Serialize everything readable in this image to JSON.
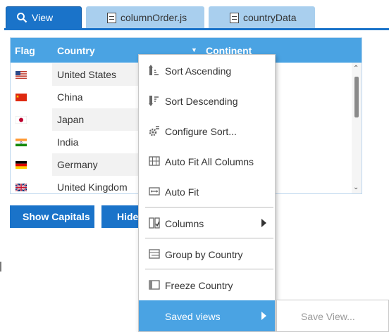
{
  "tabs": [
    {
      "label": "View",
      "icon": "search-icon"
    },
    {
      "label": "columnOrder.js",
      "icon": "file-icon"
    },
    {
      "label": "countryData",
      "icon": "file-icon"
    }
  ],
  "grid": {
    "headers": {
      "flag": "Flag",
      "country": "Country",
      "continent": "Continent"
    },
    "rows": [
      {
        "flag": "us-flag-icon",
        "country": "United States"
      },
      {
        "flag": "cn-flag-icon",
        "country": "China"
      },
      {
        "flag": "jp-flag-icon",
        "country": "Japan"
      },
      {
        "flag": "in-flag-icon",
        "country": "India"
      },
      {
        "flag": "de-flag-icon",
        "country": "Germany"
      },
      {
        "flag": "gb-flag-icon",
        "country": "United Kingdom"
      }
    ]
  },
  "buttons": {
    "show_capitals": "Show Capitals",
    "hide": "Hide"
  },
  "context_menu": {
    "sort_ascending": "Sort Ascending",
    "sort_descending": "Sort Descending",
    "configure_sort": "Configure Sort...",
    "auto_fit_all": "Auto Fit All Columns",
    "auto_fit": "Auto Fit",
    "columns": "Columns",
    "group_by": "Group by Country",
    "freeze": "Freeze Country",
    "saved_views": "Saved views"
  },
  "submenu": {
    "save_view": "Save View..."
  },
  "colors": {
    "accent": "#1a73c9",
    "header": "#4aa3e3",
    "tab_inactive": "#a9cfee"
  }
}
